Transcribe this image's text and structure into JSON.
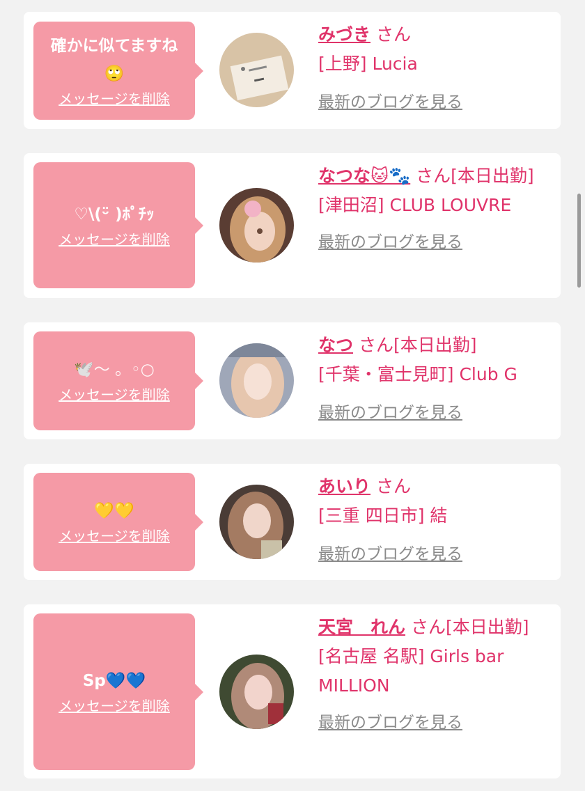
{
  "messages": [
    {
      "text": "確かに似てますね\n🙄",
      "delete_label": "メッセージを削除",
      "name": "みづき",
      "honorific": "さん",
      "status": "",
      "shop": "[上野] Lucia",
      "blog_label": "最新のブログを見る"
    },
    {
      "text": "♡\\(ᵕ̈ )ﾎﾟﾁｯ",
      "delete_label": "メッセージを削除",
      "name": "なつな🐱🐾",
      "honorific": "さん",
      "status": "[本日出勤]",
      "shop": "[津田沼] CLUB LOUVRE",
      "blog_label": "最新のブログを見る"
    },
    {
      "text": "🕊️〜 。◦○",
      "delete_label": "メッセージを削除",
      "name": "なつ",
      "honorific": "さん",
      "status": "[本日出勤]",
      "shop": "[千葉・富士見町] Club G",
      "blog_label": "最新のブログを見る"
    },
    {
      "text": "💛💛",
      "delete_label": "メッセージを削除",
      "name": "あいり",
      "honorific": "さん",
      "status": "",
      "shop": "[三重 四日市] 結",
      "blog_label": "最新のブログを見る"
    },
    {
      "text": "Sp💙💙",
      "delete_label": "メッセージを削除",
      "name": "天宮　れん",
      "honorific": "さん",
      "status": "[本日出勤]",
      "shop": "[名古屋 名駅] Girls bar MILLION",
      "blog_label": "最新のブログを見る"
    }
  ],
  "colors": {
    "accent": "#e0336a",
    "bubble": "#f59aa6",
    "link_gray": "#8a8a8a",
    "background": "#f2f2f2"
  }
}
